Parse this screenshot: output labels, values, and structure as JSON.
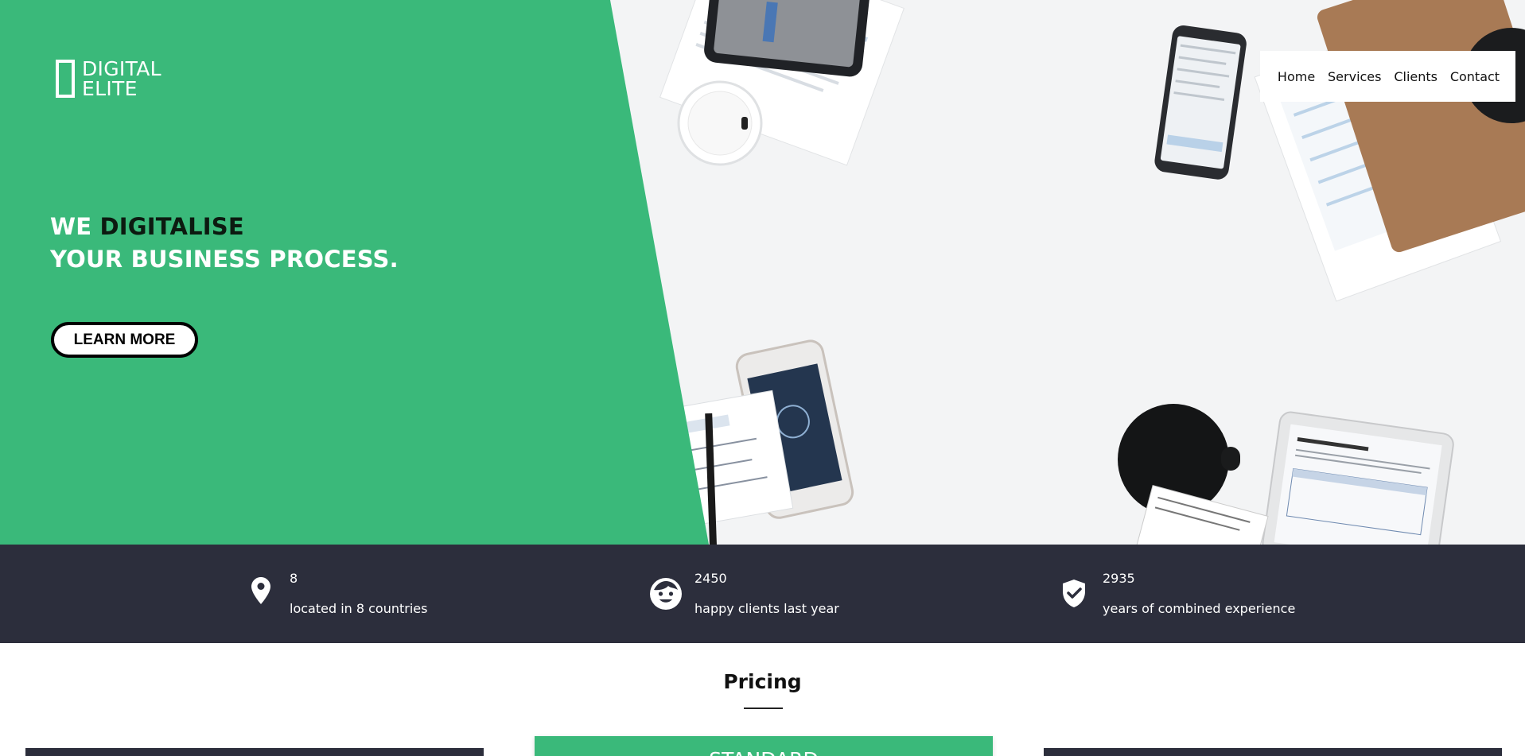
{
  "brand": {
    "line1": "DIGITAL",
    "line2": "ELITE"
  },
  "nav": {
    "items": [
      {
        "label": "Home"
      },
      {
        "label": "Services"
      },
      {
        "label": "Clients"
      },
      {
        "label": "Contact"
      }
    ]
  },
  "hero": {
    "headline_prefix": "WE ",
    "headline_accent": "DIGITALISE",
    "headline_line2": "YOUR BUSINESS PROCESS.",
    "cta_label": "LEARN MORE",
    "image_description": "",
    "colors": {
      "green": "#3ab97a",
      "accent_text": "#0c1a10"
    }
  },
  "stats": [
    {
      "icon": "map-pin-icon",
      "value": "8",
      "label": "located in 8 countries"
    },
    {
      "icon": "smiley-face-icon",
      "value": "2450",
      "label": "happy clients last year"
    },
    {
      "icon": "shield-check-icon",
      "value": "2935",
      "label": "years of combined experience"
    }
  ],
  "stats_bar_color": "#2c2e3c",
  "pricing": {
    "title": "Pricing",
    "cards": [
      {
        "name": ""
      },
      {
        "name": "STANDARD"
      },
      {
        "name": ""
      }
    ]
  }
}
